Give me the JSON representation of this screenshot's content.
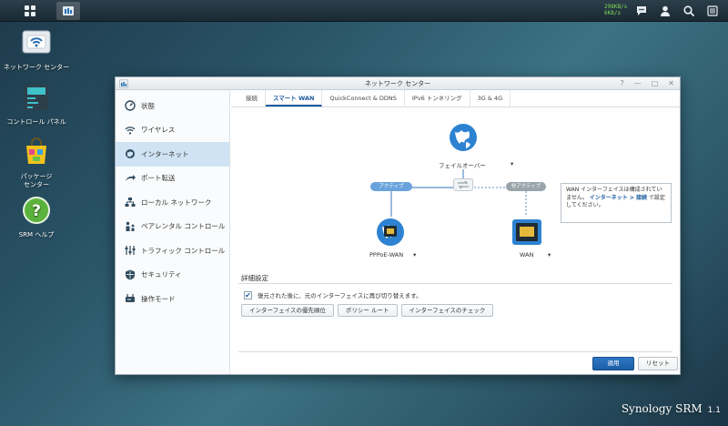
{
  "taskbar": {
    "speed_up": "298KB/s",
    "speed_down": "6KB/s"
  },
  "desktop": {
    "icons": [
      {
        "label": "ネットワーク センター"
      },
      {
        "label": "コントロール パネル"
      },
      {
        "label": "パッケージ\nセンター"
      },
      {
        "label": "SRM ヘルプ"
      }
    ]
  },
  "window": {
    "title": "ネットワーク センター",
    "controls": {
      "help": "?",
      "minimize": "—",
      "maximize": "□",
      "close": "✕"
    }
  },
  "sidebar": {
    "items": [
      {
        "label": "状態",
        "icon": "status-icon"
      },
      {
        "label": "ワイヤレス",
        "icon": "wifi-icon"
      },
      {
        "label": "インターネット",
        "icon": "globe-icon",
        "active": true
      },
      {
        "label": "ポート転送",
        "icon": "port-forward-icon"
      },
      {
        "label": "ローカル ネットワーク",
        "icon": "local-network-icon"
      },
      {
        "label": "ペアレンタル コントロール",
        "icon": "parental-icon"
      },
      {
        "label": "トラフィック コントロール",
        "icon": "traffic-icon"
      },
      {
        "label": "セキュリティ",
        "icon": "shield-icon"
      },
      {
        "label": "操作モード",
        "icon": "operation-mode-icon"
      }
    ]
  },
  "tabs": [
    {
      "label": "接続"
    },
    {
      "label": "スマート WAN",
      "active": true
    },
    {
      "label": "QuickConnect & DDNS"
    },
    {
      "label": "IPv6 トンネリング"
    },
    {
      "label": "3G & 4G"
    }
  ],
  "diagram": {
    "top_node": "フェイルオーバー",
    "left_status": "アクティブ",
    "right_status": "非アクティブ",
    "left_node": "PPPoE-WAN",
    "right_node": "WAN",
    "tooltip_text": "WAN インターフェイスは構成されていません。",
    "tooltip_link": "インターネット > 接続",
    "tooltip_suffix": " で設定してください。",
    "colors": {
      "active": "#6aa3dc",
      "inactive": "#9aa4ab",
      "line": "#5b8fc4"
    }
  },
  "advanced": {
    "title": "詳細設定",
    "checkbox_label": "復元された後に、元のインターフェイスに再び切り替えます。",
    "checkbox_checked": true,
    "buttons": [
      {
        "label": "インターフェイスの優先順位"
      },
      {
        "label": "ポリシー ルート"
      },
      {
        "label": "インターフェイスのチェック"
      }
    ]
  },
  "footer": {
    "apply_label": "適用",
    "reset_label": "リセット"
  },
  "brand": {
    "name": "Synology SRM",
    "version": "1.1"
  }
}
